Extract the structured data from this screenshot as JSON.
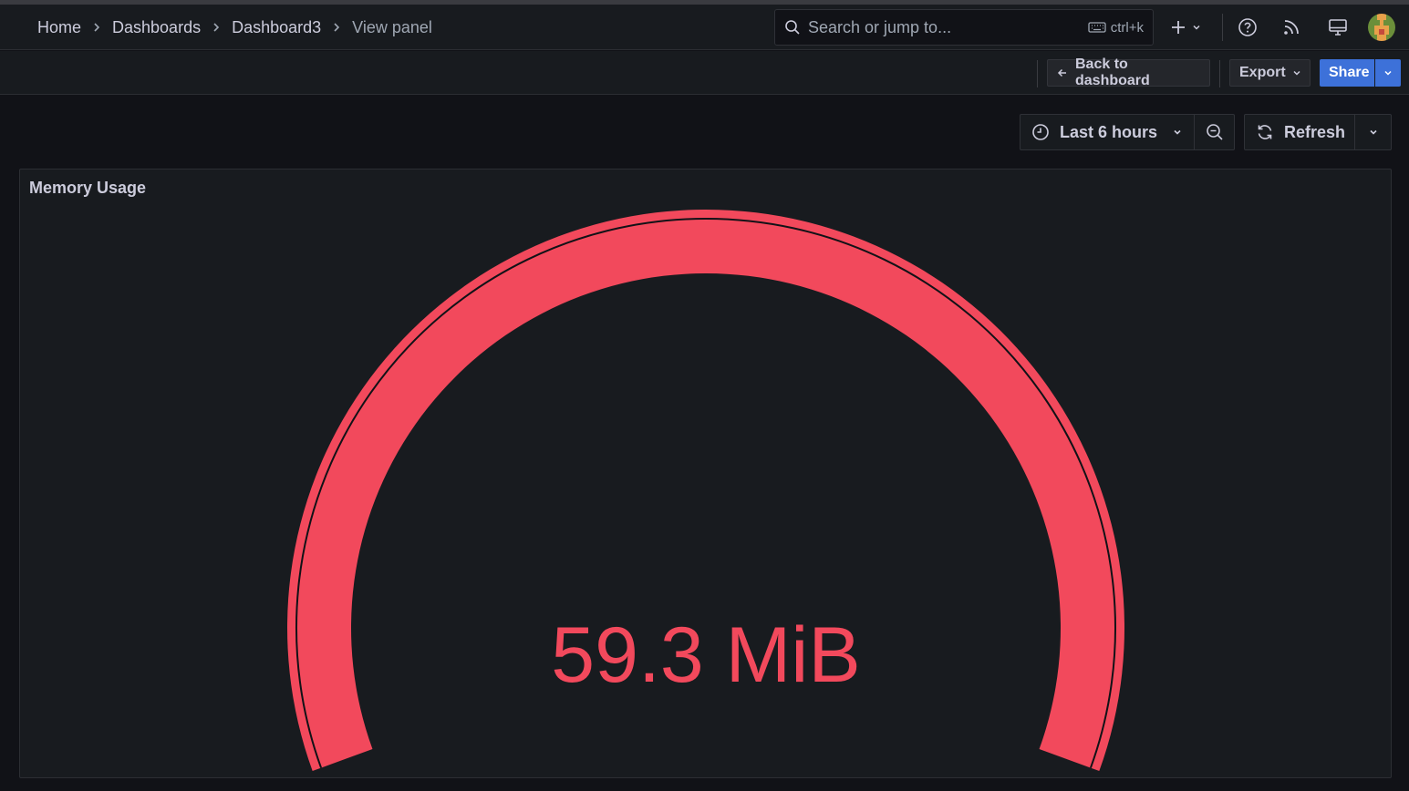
{
  "breadcrumb": {
    "home": "Home",
    "dashboards": "Dashboards",
    "dashboard": "Dashboard3",
    "current": "View panel"
  },
  "search": {
    "placeholder": "Search or jump to...",
    "shortcut": "ctrl+k"
  },
  "actions": {
    "back": "Back to dashboard",
    "export": "Export",
    "share": "Share"
  },
  "time_picker": {
    "range": "Last 6 hours",
    "refresh": "Refresh"
  },
  "panel": {
    "title": "Memory Usage",
    "value_text": "59.3 MiB",
    "gauge_color": "#f2495c",
    "gauge_fill_fraction": 1.0
  },
  "colors": {
    "primary": "#3d71d9",
    "background": "#111217",
    "panel": "#181b1f"
  },
  "icons": {
    "search": "search-icon",
    "keyboard": "keyboard-icon",
    "add": "plus-icon",
    "help": "help-icon",
    "news": "rss-icon",
    "kiosk": "monitor-icon",
    "clock": "clock-icon",
    "zoom_out": "zoom-out-icon",
    "refresh": "refresh-icon"
  }
}
